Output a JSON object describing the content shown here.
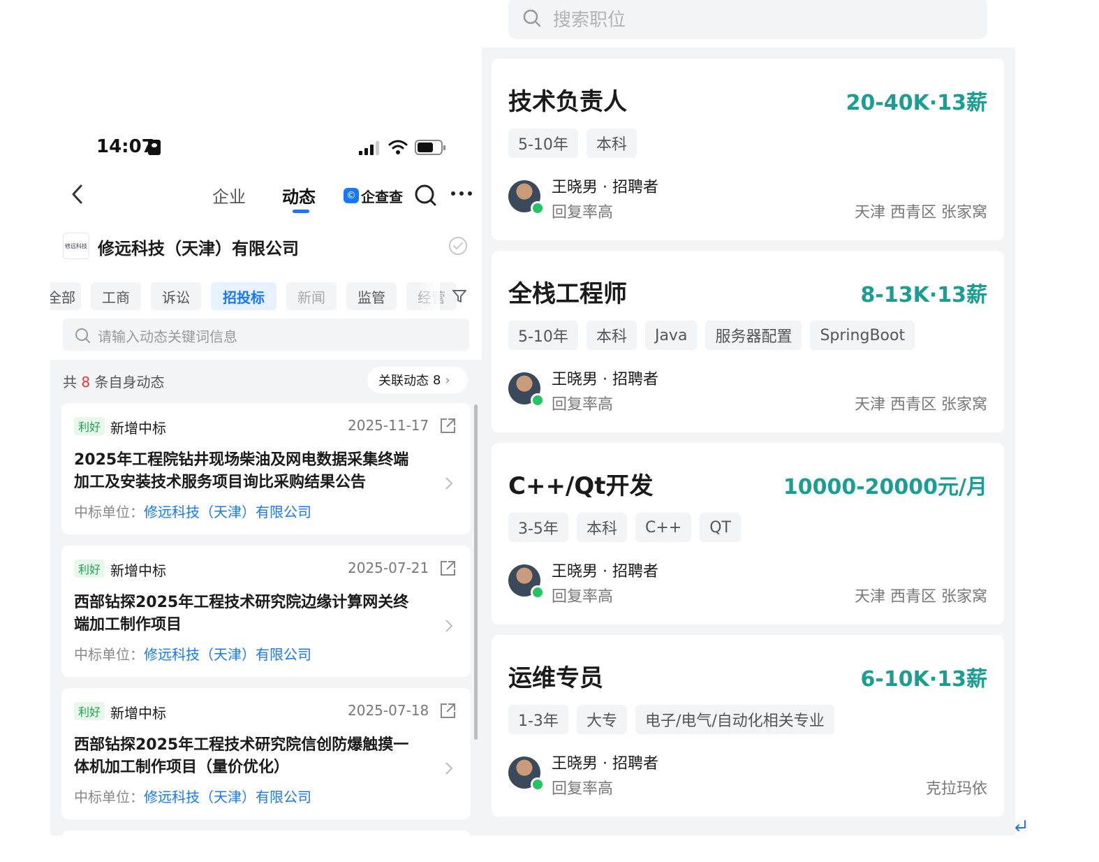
{
  "left": {
    "status": {
      "time": "14:07"
    },
    "nav": {
      "tabs": [
        "企业",
        "动态"
      ],
      "brand": "企查查"
    },
    "company": {
      "logo_text": "修远科技",
      "name": "修远科技（天津）有限公司"
    },
    "filters": [
      "全部",
      "工商",
      "诉讼",
      "招投标",
      "新闻",
      "监管",
      "经营"
    ],
    "keyword_search": {
      "placeholder": "请输入动态关键词信息"
    },
    "summary": {
      "prefix": "共",
      "count": "8",
      "suffix": "条自身动态",
      "related_label": "关联动态",
      "related_count": "8"
    },
    "cards": [
      {
        "tag": "利好",
        "type": "新增中标",
        "date": "2025-11-17",
        "title": "2025年工程院钻井现场柴油及网电数据采集终端加工及安装技术服务项目询比采购结果公告",
        "winner_label": "中标单位：",
        "winner": "修远科技（天津）有限公司"
      },
      {
        "tag": "利好",
        "type": "新增中标",
        "date": "2025-07-21",
        "title": "西部钻探2025年工程技术研究院边缘计算网关终端加工制作项目",
        "winner_label": "中标单位：",
        "winner": "修远科技（天津）有限公司"
      },
      {
        "tag": "利好",
        "type": "新增中标",
        "date": "2025-07-18",
        "title": "西部钻探2025年工程技术研究院信创防爆触摸一体机加工制作项目（量价优化）",
        "winner_label": "中标单位：",
        "winner": "修远科技（天津）有限公司"
      }
    ]
  },
  "right": {
    "search": {
      "placeholder": "搜索职位"
    },
    "jobs": [
      {
        "title": "技术负责人",
        "salary": "20-40K·13薪",
        "tags": [
          "5-10年",
          "本科"
        ],
        "recruiter": "王晓男 · 招聘者",
        "reply": "回复率高",
        "location": "天津 西青区 张家窝"
      },
      {
        "title": "全栈工程师",
        "salary": "8-13K·13薪",
        "tags": [
          "5-10年",
          "本科",
          "Java",
          "服务器配置",
          "SpringBoot"
        ],
        "recruiter": "王晓男 · 招聘者",
        "reply": "回复率高",
        "location": "天津 西青区 张家窝"
      },
      {
        "title": "C++/Qt开发",
        "salary": "10000-20000元/月",
        "tags": [
          "3-5年",
          "本科",
          "C++",
          "QT"
        ],
        "recruiter": "王晓男 · 招聘者",
        "reply": "回复率高",
        "location": "天津 西青区 张家窝"
      },
      {
        "title": "运维专员",
        "salary": "6-10K·13薪",
        "tags": [
          "1-3年",
          "大专",
          "电子/电气/自动化相关专业"
        ],
        "recruiter": "王晓男 · 招聘者",
        "reply": "回复率高",
        "location": "克拉玛依"
      }
    ]
  },
  "colors": {
    "accent_blue": "#1677ff",
    "salary_teal": "#1a9e93",
    "good_green": "#21a24a",
    "count_red": "#e53935"
  },
  "icons": [
    "back-icon",
    "search-icon",
    "more-icon",
    "verify-icon",
    "filter-icon",
    "share-icon",
    "chevron-right-icon",
    "enter-icon"
  ]
}
